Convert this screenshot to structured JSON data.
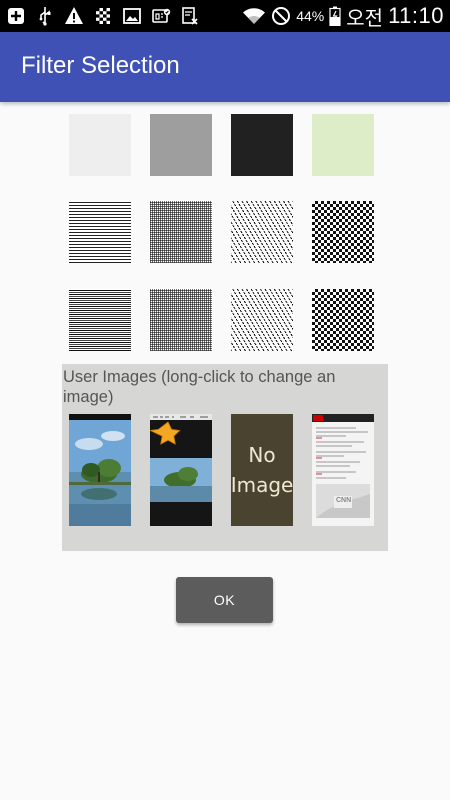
{
  "status_bar": {
    "battery_percent": "44%",
    "ampm": "오전",
    "time": "11:10",
    "left_icons": [
      "add-box-icon",
      "usb-icon",
      "warning-icon",
      "checkered-flag-icon",
      "gallery-icon",
      "sim-icon",
      "sync-icon"
    ],
    "right_icons": [
      "wifi-icon",
      "do-not-disturb-icon",
      "battery-icon"
    ]
  },
  "app_bar": {
    "title": "Filter Selection",
    "color": "#3f51b5"
  },
  "filters": {
    "rows": [
      [
        {
          "name": "light-gray",
          "color": "#eeeeee"
        },
        {
          "name": "gray",
          "color": "#9e9e9e"
        },
        {
          "name": "black",
          "color": "#212121"
        },
        {
          "name": "light-green",
          "color": "#dcedc8"
        }
      ],
      [
        {
          "name": "horizontal-lines",
          "pattern": "hlines-a"
        },
        {
          "name": "fine-grid",
          "pattern": "fine"
        },
        {
          "name": "diagonal-dashes",
          "pattern": "diag"
        },
        {
          "name": "checkerboard",
          "pattern": "checker"
        }
      ],
      [
        {
          "name": "horizontal-lines-dense",
          "pattern": "hlines-b"
        },
        {
          "name": "fine-grid-dense",
          "pattern": "fine"
        },
        {
          "name": "diagonal-dashes-dense",
          "pattern": "diag"
        },
        {
          "name": "checkerboard-dense",
          "pattern": "checker"
        }
      ]
    ]
  },
  "user_images": {
    "label": "User Images   (long-click to change an image)",
    "panel_color": "#d6d6d4",
    "placeholder_text_line1": "No",
    "placeholder_text_line2": "Image",
    "cnn_logo_text": "CNN"
  },
  "ok_button": {
    "label": "OK"
  }
}
